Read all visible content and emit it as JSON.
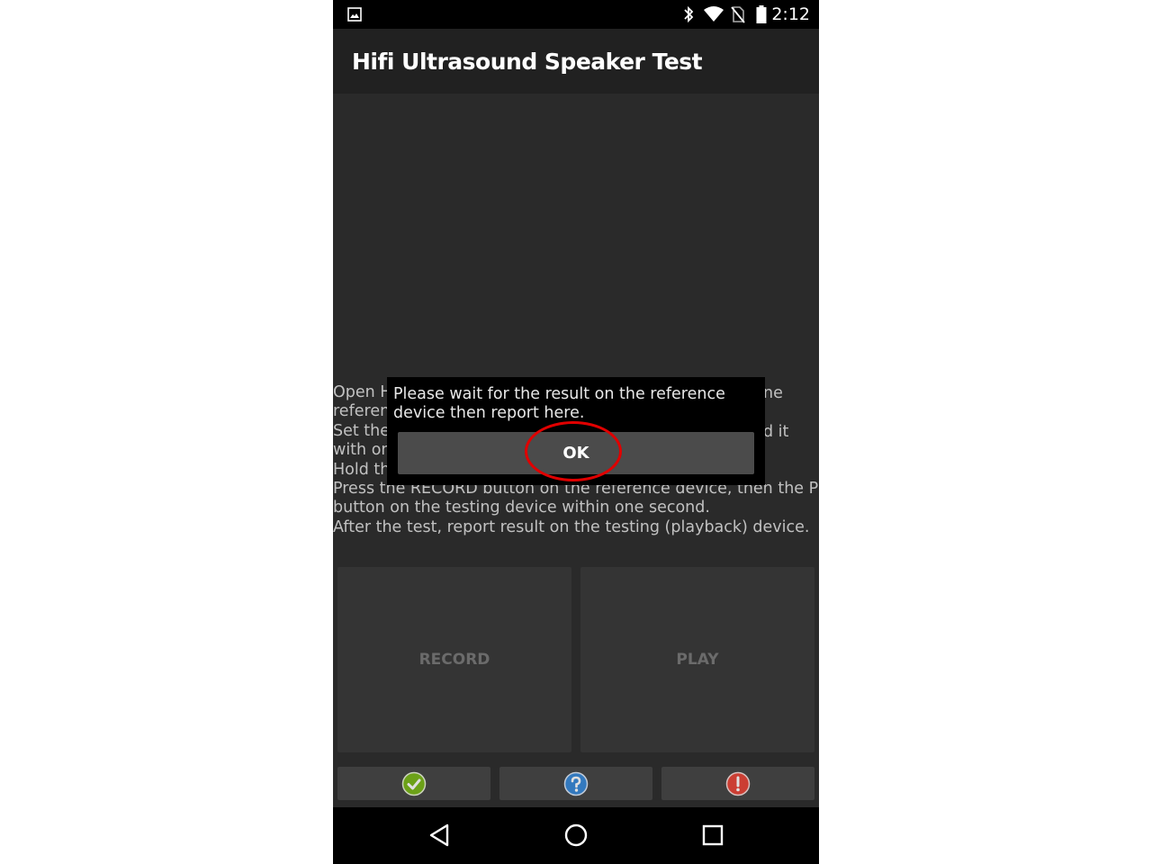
{
  "status_bar": {
    "time": "2:12",
    "icons": [
      "image-icon",
      "bluetooth-icon",
      "wifi-icon",
      "no-sim-icon",
      "battery-icon"
    ]
  },
  "app_bar": {
    "title": "Hifi Ultrasound Speaker Test"
  },
  "instructions": {
    "lines": [
      "Open H",
      "referen",
      " Set the",
      "with on",
      " Hold th",
      " Press the RECORD button on the reference device, then the PLAY",
      "button on the testing device within one second.",
      " After the test, report result on the testing (playback) device."
    ],
    "right_fragments": [
      "ne",
      "d it"
    ]
  },
  "buttons": {
    "record": "RECORD",
    "play": "PLAY"
  },
  "result_buttons": {
    "pass": {
      "icon": "check-icon",
      "color": "#7cb81c"
    },
    "info": {
      "icon": "question-icon",
      "color": "#3b8ad9"
    },
    "fail": {
      "icon": "exclamation-icon",
      "color": "#e8473b"
    }
  },
  "dialog": {
    "message": "Please wait for the result on the reference device then report here.",
    "ok_label": "OK"
  },
  "colors": {
    "highlight": "#e00000"
  },
  "nav_bar": {
    "buttons": [
      "back-icon",
      "home-icon",
      "recents-icon"
    ]
  }
}
